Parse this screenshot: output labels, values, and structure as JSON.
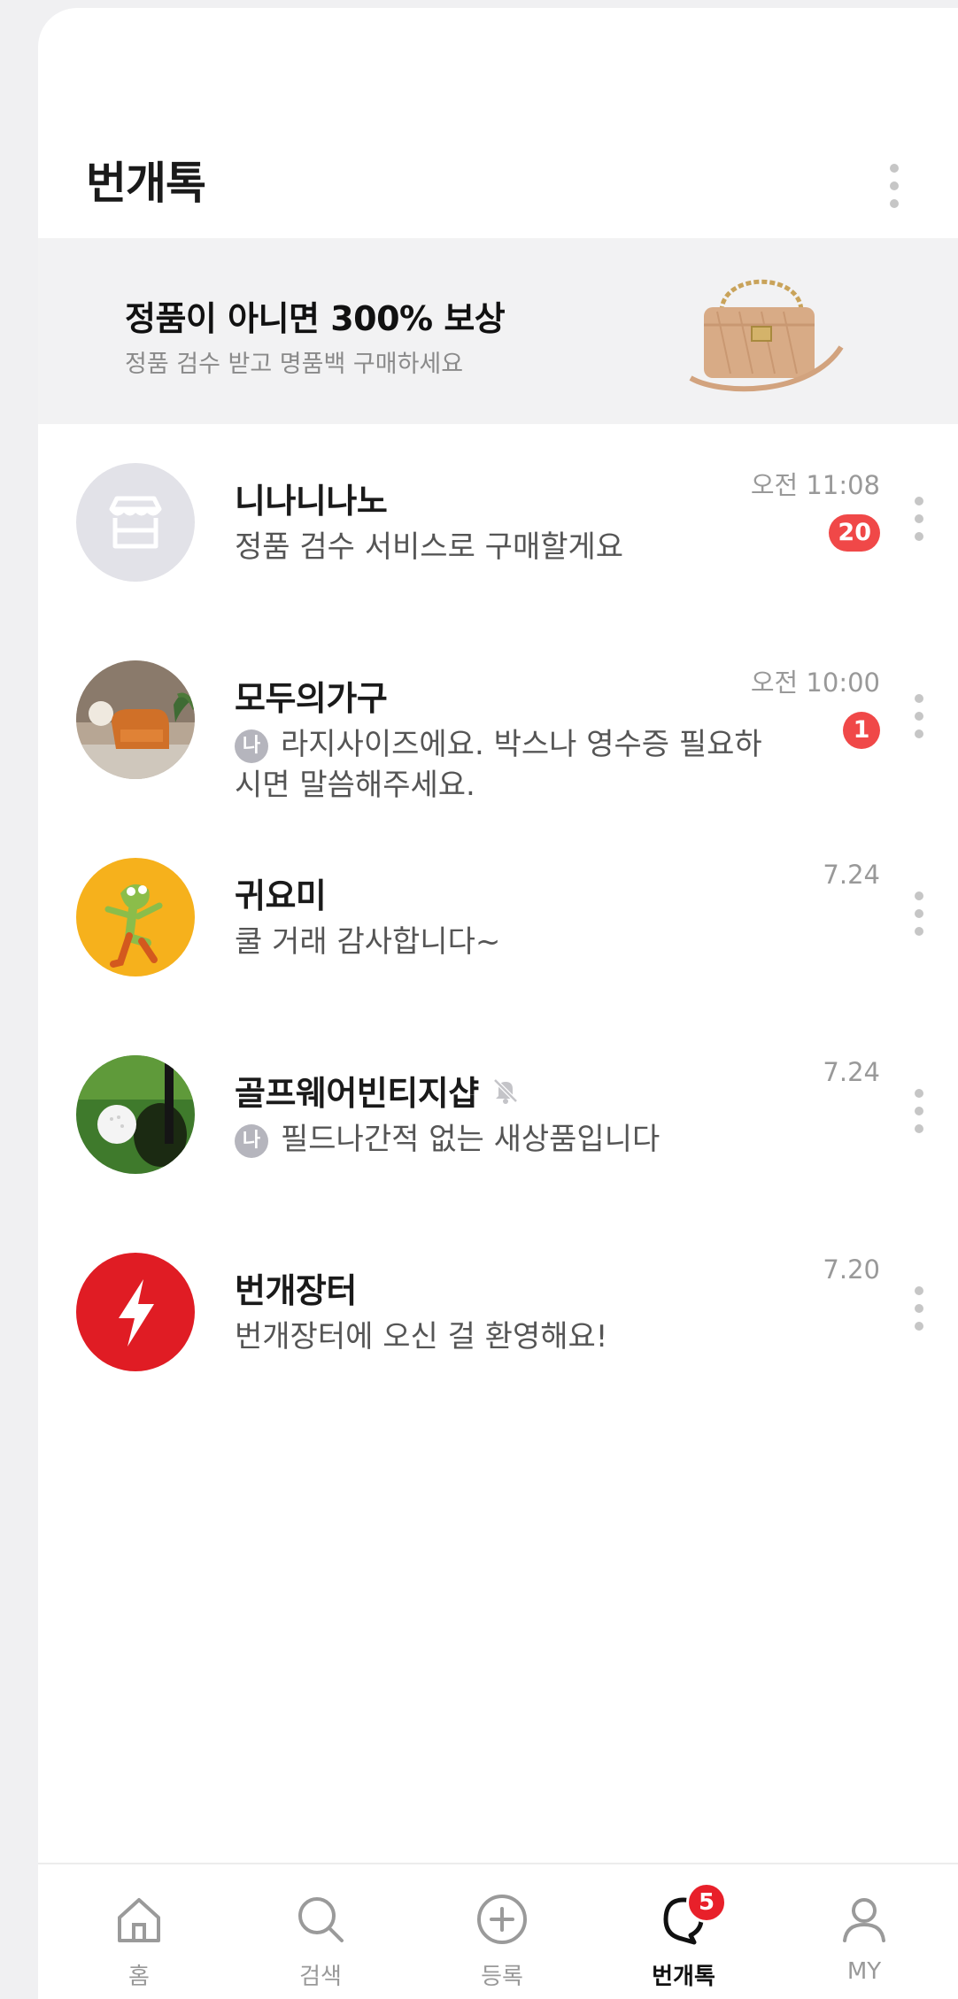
{
  "header": {
    "title": "번개톡"
  },
  "banner": {
    "title": "정품이 아니면 300% 보상",
    "subtitle": "정품 검수 받고 명품백 구매하세요"
  },
  "chats": [
    {
      "name": "니나니나노",
      "message": "정품 검수 서비스로 구매할게요",
      "time": "오전 11:08",
      "unread": "20",
      "avatar": "store-icon"
    },
    {
      "name": "모두의가구",
      "me_badge": "나",
      "message": "라지사이즈에요. 박스나 영수증 필요하시면 말씀해주세요.",
      "time": "오전 10:00",
      "unread": "1",
      "avatar": "furniture-photo"
    },
    {
      "name": "귀요미",
      "message": "쿨 거래 감사합니다~",
      "time": "7.24",
      "avatar": "frog-illustration"
    },
    {
      "name": "골프웨어빈티지샵",
      "me_badge": "나",
      "message": "필드나간적 없는 새상품입니다",
      "time": "7.24",
      "muted": true,
      "avatar": "golf-ball-photo"
    },
    {
      "name": "번개장터",
      "message": "번개장터에 오신 걸 환영해요!",
      "time": "7.20",
      "avatar": "bolt-logo"
    }
  ],
  "bottom_nav": {
    "home": "홈",
    "search": "검색",
    "register": "등록",
    "chat": "번개톡",
    "chat_badge": "5",
    "my": "MY"
  },
  "colors": {
    "badge_red": "#f04848",
    "brand_red": "#e01c24",
    "banner_bg": "#f2f2f3"
  }
}
